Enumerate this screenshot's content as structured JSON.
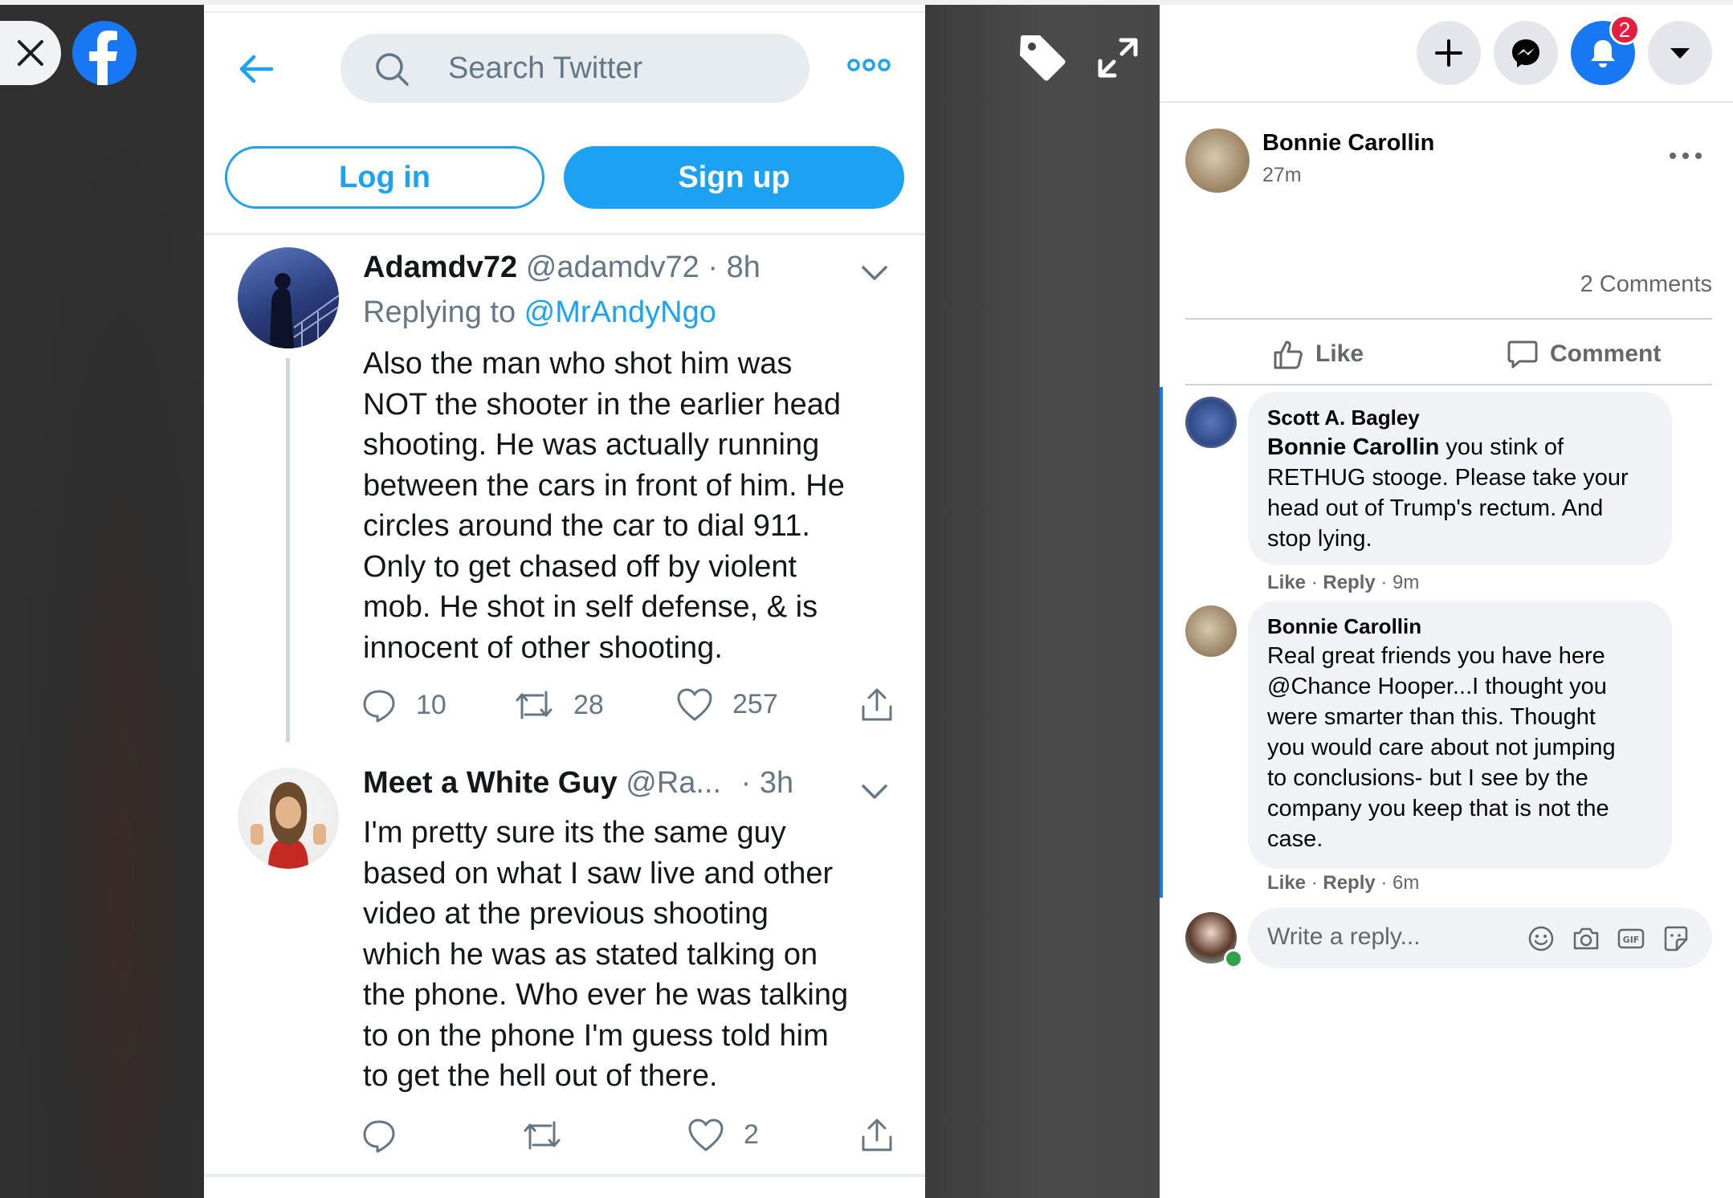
{
  "viewer": {
    "close_icon": "close-icon",
    "brand_icon": "facebook-logo-icon",
    "tag_icon": "tag-icon",
    "expand_icon": "expand-icon"
  },
  "twitter": {
    "search_placeholder": "Search Twitter",
    "login_label": "Log in",
    "signup_label": "Sign up",
    "tweets": [
      {
        "name": "Adamdv72",
        "handle": "@adamdv72",
        "time": "· 8h",
        "replying_prefix": "Replying to ",
        "replying_to": "@MrAndyNgo",
        "lines": [
          "Also the man who shot him was",
          "NOT the shooter in the earlier head",
          "shooting. He was actually running",
          "between the cars in front of him. He",
          "circles around the car to dial 911.",
          "Only to get chased off by violent",
          "mob. He shot in self defense, & is",
          "innocent of other shooting."
        ],
        "replies": "10",
        "retweets": "28",
        "likes": "257"
      },
      {
        "name": "Meet a White Guy",
        "handle": "@Ra...",
        "time": "· 3h",
        "lines": [
          "I'm pretty sure its the same guy",
          "based on what I saw live and other",
          "video at the previous shooting",
          "which he was as stated talking on",
          "the phone. Who ever he was talking",
          "to on the phone I'm guess told him",
          "to get the hell out of there."
        ],
        "replies": "",
        "retweets": "",
        "likes": "2"
      }
    ]
  },
  "facebook": {
    "notification_count": "2",
    "post_author": "Bonnie Carollin",
    "post_time": "27m",
    "comment_count": "2 Comments",
    "like_label": "Like",
    "comment_label": "Comment",
    "comments": [
      {
        "author": "Scott A. Bagley",
        "mention": "Bonnie Carollin",
        "lines": [
          " you stink of",
          "RETHUG stooge. Please take your",
          "head out of Trump's rectum. And",
          "stop lying."
        ],
        "like": "Like",
        "reply": "Reply",
        "time": "9m"
      },
      {
        "author": "Bonnie Carollin",
        "lines": [
          "Real great friends you have here",
          "@Chance Hooper...I thought you",
          "were smarter than this. Thought",
          "you would care about not jumping",
          "to conclusions- but I see by the",
          "company you keep that is not the",
          "case."
        ],
        "like": "Like",
        "reply": "Reply",
        "time": "6m"
      }
    ],
    "reply_placeholder": "Write a reply...",
    "colors": {
      "accent": "#1877f2",
      "twitter_blue": "#1da1f2"
    }
  }
}
